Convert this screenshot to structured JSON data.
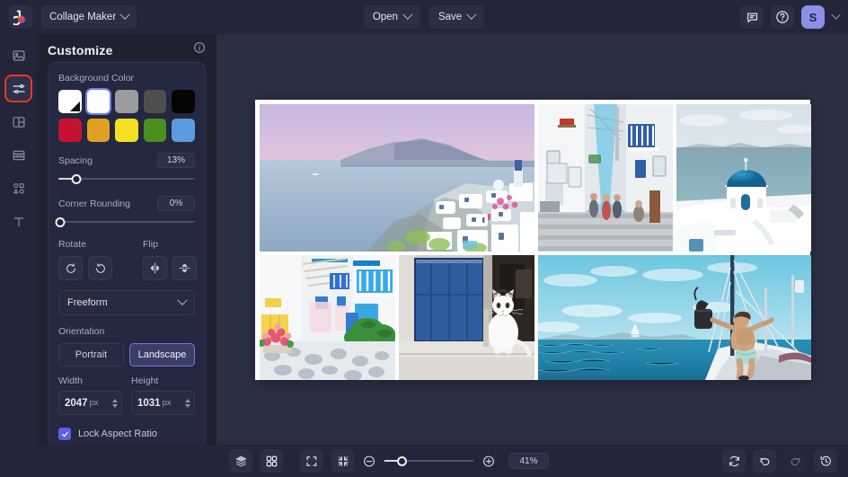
{
  "app": {
    "logo": "bazaart-logo-icon",
    "menu_label": "Collage Maker"
  },
  "topbar": {
    "open_label": "Open",
    "save_label": "Save",
    "feedback_icon": "chat-icon",
    "help_icon": "help-circle-icon",
    "avatar_initial": "S"
  },
  "rail": {
    "items": [
      {
        "name": "photos",
        "icon": "image-icon",
        "active": false
      },
      {
        "name": "customize",
        "icon": "sliders-icon",
        "active": true
      },
      {
        "name": "layout",
        "icon": "layout-grid-icon",
        "active": false
      },
      {
        "name": "layers",
        "icon": "layers-list-icon",
        "active": false
      },
      {
        "name": "shapes",
        "icon": "shapes-icon",
        "active": false
      },
      {
        "name": "text",
        "icon": "text-icon",
        "active": false
      }
    ]
  },
  "panel": {
    "title": "Customize",
    "info_icon": "info-circle-icon",
    "background_color": {
      "label": "Background Color",
      "swatches": [
        {
          "name": "custom",
          "hex": "#ffffff",
          "custom": true,
          "selected": false
        },
        {
          "name": "white",
          "hex": "#ffffff",
          "custom": false,
          "selected": true
        },
        {
          "name": "gray",
          "hex": "#9c9c9c",
          "custom": false,
          "selected": false
        },
        {
          "name": "dark-gray",
          "hex": "#4f4f4f",
          "custom": false,
          "selected": false
        },
        {
          "name": "black",
          "hex": "#050505",
          "custom": false,
          "selected": false
        },
        {
          "name": "crimson",
          "hex": "#c51234",
          "custom": false,
          "selected": false
        },
        {
          "name": "orange",
          "hex": "#e2a022",
          "custom": false,
          "selected": false
        },
        {
          "name": "yellow",
          "hex": "#f4e121",
          "custom": false,
          "selected": false
        },
        {
          "name": "green",
          "hex": "#4c8f20",
          "custom": false,
          "selected": false
        },
        {
          "name": "blue",
          "hex": "#5b9ce0",
          "custom": false,
          "selected": false
        }
      ]
    },
    "spacing": {
      "label": "Spacing",
      "value": "13%",
      "percent": 13
    },
    "corner_rounding": {
      "label": "Corner Rounding",
      "value": "0%",
      "percent": 0
    },
    "rotate": {
      "label": "Rotate",
      "counterclockwise_icon": "rotate-ccw-icon",
      "clockwise_icon": "rotate-cw-icon"
    },
    "flip": {
      "label": "Flip",
      "horizontal_icon": "flip-horizontal-icon",
      "vertical_icon": "flip-vertical-icon"
    },
    "aspect_select": {
      "value": "Freeform",
      "chevron_icon": "chevron-down-icon"
    },
    "orientation": {
      "label": "Orientation",
      "portrait_label": "Portrait",
      "landscape_label": "Landscape",
      "selected": "Landscape"
    },
    "width": {
      "label": "Width",
      "value": "2047",
      "unit": "px"
    },
    "height": {
      "label": "Height",
      "value": "1031",
      "unit": "px"
    },
    "lock_aspect_ratio": {
      "label": "Lock Aspect Ratio",
      "checked": true
    }
  },
  "canvas": {
    "cells": [
      {
        "name": "cell-santorini-sunset",
        "alt": "Santorini caldera at sunset with pink purple sky"
      },
      {
        "name": "cell-greek-alley",
        "alt": "Narrow Greek alley with white walls and blue balconies"
      },
      {
        "name": "cell-blue-dome-church",
        "alt": "Blue domed church overlooking the sea"
      },
      {
        "name": "cell-flower-street",
        "alt": "Whitewashed street with pink flowers and blue doors"
      },
      {
        "name": "cell-white-cat",
        "alt": "White cat sitting beside a blue door"
      },
      {
        "name": "cell-sailboat-man",
        "alt": "Man on sailboat bow with arms outstretched over turquoise sea"
      }
    ]
  },
  "bottombar": {
    "layers_icon": "layers-icon",
    "grid_icon": "grid-icon",
    "fullscreen_icon": "fullscreen-icon",
    "fit_icon": "fit-to-screen-icon",
    "zoom_out_icon": "zoom-out-icon",
    "zoom_in_icon": "zoom-in-icon",
    "zoom_value": "41%",
    "zoom_percent": 41,
    "reset_icon": "reset-icon",
    "undo_icon": "undo-icon",
    "redo_icon": "redo-icon",
    "history_icon": "history-icon"
  }
}
